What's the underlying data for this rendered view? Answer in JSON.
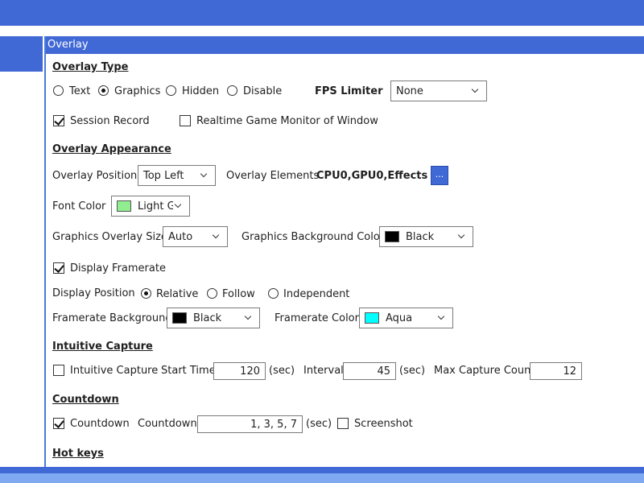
{
  "panel": {
    "title": "Overlay"
  },
  "overlay_type": {
    "heading": "Overlay Type",
    "options": [
      "Text",
      "Graphics",
      "Hidden",
      "Disable"
    ],
    "selected": "Graphics",
    "fps_label": "FPS Limiter",
    "fps_value": "None",
    "session_record": "Session Record",
    "realtime_monitor": "Realtime Game Monitor of Window"
  },
  "appearance": {
    "heading": "Overlay Appearance",
    "position_label": "Overlay Position",
    "position_value": "Top Left",
    "elements_label": "Overlay Elements",
    "elements_value": "CPU0,GPU0,Effects",
    "elements_button": "...",
    "font_color_label": "Font Color",
    "font_color_value": "Light G",
    "font_color_hex": "#90ee90",
    "size_label": "Graphics Overlay Size",
    "size_value": "Auto",
    "bg_color_label": "Graphics Background Color",
    "bg_color_value": "Black",
    "bg_color_hex": "#000000",
    "display_framerate": "Display Framerate",
    "display_position_label": "Display Position",
    "display_position_options": [
      "Relative",
      "Follow",
      "Independent"
    ],
    "display_position_selected": "Relative",
    "framerate_bg_label": "Framerate Background",
    "framerate_bg_value": "Black",
    "framerate_bg_hex": "#000000",
    "framerate_color_label": "Framerate Color",
    "framerate_color_value": "Aqua",
    "framerate_color_hex": "#00ffff"
  },
  "capture": {
    "heading": "Intuitive Capture",
    "checkbox": "Intuitive Capture",
    "start_label": "Start Time",
    "start_value": "120",
    "sec1": "(sec)",
    "interval_label": "Interval",
    "interval_value": "45",
    "sec2": "(sec)",
    "max_label": "Max Capture Count",
    "max_value": "12"
  },
  "countdown": {
    "heading": "Countdown",
    "checkbox": "Countdown",
    "label": "Countdown",
    "value": "1, 3, 5, 7",
    "sec": "(sec)",
    "screenshot": "Screenshot"
  },
  "hotkeys": {
    "heading": "Hot keys"
  },
  "colors": {
    "accent": "#4169d6"
  }
}
